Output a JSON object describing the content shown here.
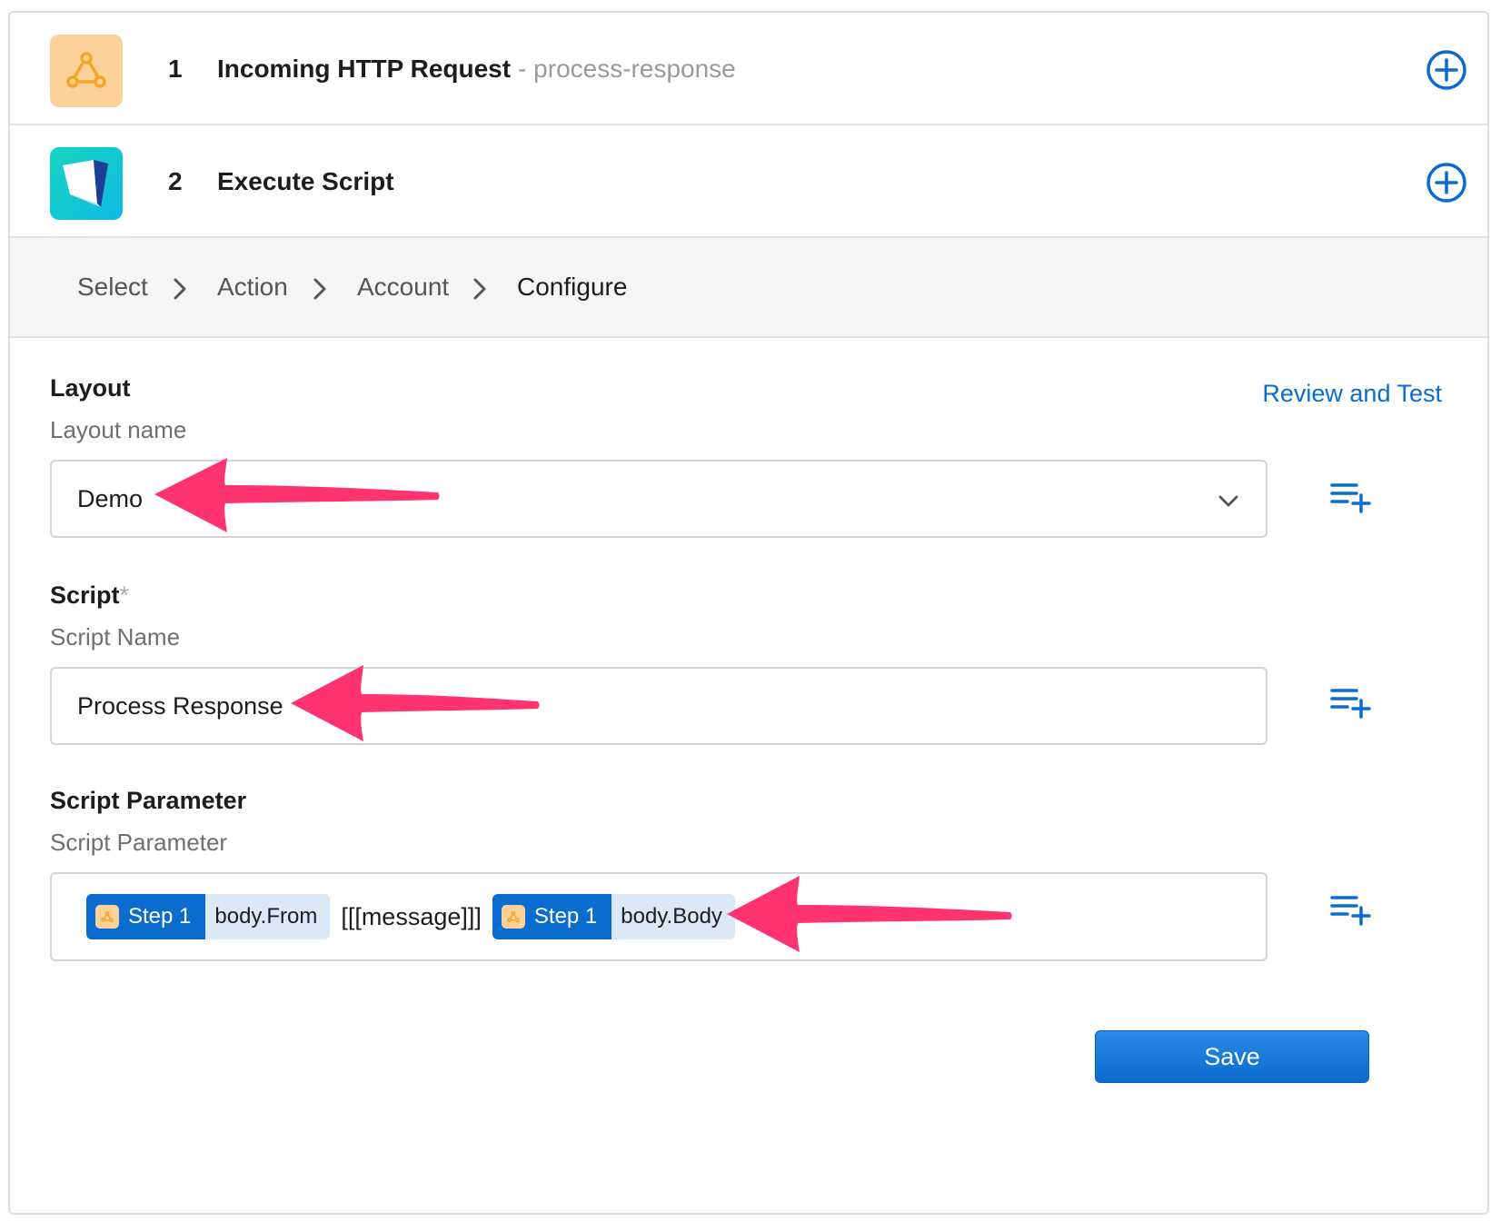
{
  "steps": [
    {
      "number": "1",
      "title": "Incoming HTTP Request",
      "subtitle": "- process-response",
      "icon": "webhook-icon"
    },
    {
      "number": "2",
      "title": "Execute Script",
      "subtitle": "",
      "icon": "filemaker-icon"
    }
  ],
  "breadcrumbs": [
    "Select",
    "Action",
    "Account",
    "Configure"
  ],
  "review_link": "Review and Test",
  "fields": {
    "layout": {
      "label": "Layout",
      "required_mark": "",
      "hint": "Layout name",
      "value": "Demo"
    },
    "script": {
      "label": "Script",
      "required_mark": "*",
      "hint": "Script Name",
      "value": "Process Response"
    },
    "script_parameter": {
      "label": "Script Parameter",
      "hint": "Script Parameter",
      "tokens": [
        {
          "step": "Step 1",
          "field": "body.From"
        },
        {
          "literal": "[[[message]]]"
        },
        {
          "step": "Step 1",
          "field": "body.Body"
        }
      ]
    }
  },
  "save_label": "Save",
  "colors": {
    "accent": "#0a6ccf",
    "annotation_arrow": "#ff3370",
    "webhook_tile": "#fcd29a"
  }
}
